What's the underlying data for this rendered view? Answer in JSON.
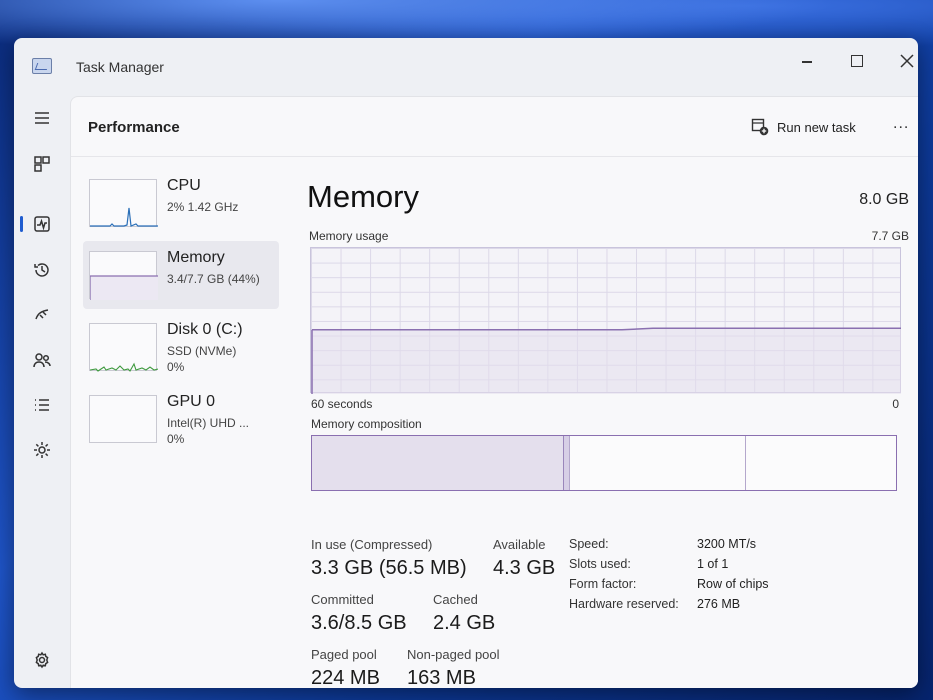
{
  "window": {
    "title": "Task Manager"
  },
  "header": {
    "page_title": "Performance",
    "run_new_task": "Run new task",
    "more": "..."
  },
  "devices": [
    {
      "name": "CPU",
      "line1": "2% 1.42 GHz",
      "line2": ""
    },
    {
      "name": "Memory",
      "line1": "3.4/7.7 GB (44%)",
      "line2": ""
    },
    {
      "name": "Disk 0 (C:)",
      "line1": "SSD (NVMe)",
      "line2": "0%"
    },
    {
      "name": "GPU 0",
      "line1": "Intel(R) UHD ...",
      "line2": "0%"
    }
  ],
  "memory": {
    "title": "Memory",
    "total": "8.0 GB",
    "usage_label": "Memory usage",
    "usage_max": "7.7 GB",
    "axis_left": "60 seconds",
    "axis_right": "0",
    "composition_label": "Memory composition",
    "composition": {
      "in_use_fraction": 0.43,
      "modified_fraction": 0.01,
      "standby_fraction": 0.3,
      "free_fraction": 0.26
    },
    "usage_history_fraction": [
      0.44,
      0.44,
      0.44,
      0.44,
      0.44,
      0.44,
      0.44,
      0.44,
      0.44,
      0.44,
      0.44,
      0.45,
      0.45,
      0.45,
      0.45,
      0.45,
      0.45,
      0.45,
      0.45,
      0.45
    ],
    "stats": {
      "in_use_label": "In use (Compressed)",
      "in_use_value": "3.3 GB (56.5 MB)",
      "available_label": "Available",
      "available_value": "4.3 GB",
      "committed_label": "Committed",
      "committed_value": "3.6/8.5 GB",
      "cached_label": "Cached",
      "cached_value": "2.4 GB",
      "paged_pool_label": "Paged pool",
      "paged_pool_value": "224 MB",
      "non_paged_pool_label": "Non-paged pool",
      "non_paged_pool_value": "163 MB"
    },
    "specs": {
      "speed_label": "Speed:",
      "speed_value": "3200 MT/s",
      "slots_label": "Slots used:",
      "slots_value": "1 of 1",
      "form_factor_label": "Form factor:",
      "form_factor_value": "Row of chips",
      "hw_reserved_label": "Hardware reserved:",
      "hw_reserved_value": "276 MB"
    }
  },
  "colors": {
    "accent": "#1f5ccf",
    "memory_line": "#8a6fb0",
    "memory_fill": "#e4dfed",
    "cpu_line": "#2a6fb8",
    "disk_line": "#3f9a3f"
  },
  "nav_icons": [
    "hamburger-icon",
    "processes-icon",
    "performance-icon",
    "app-history-icon",
    "startup-apps-icon",
    "users-icon",
    "details-icon",
    "services-icon",
    "settings-icon"
  ]
}
